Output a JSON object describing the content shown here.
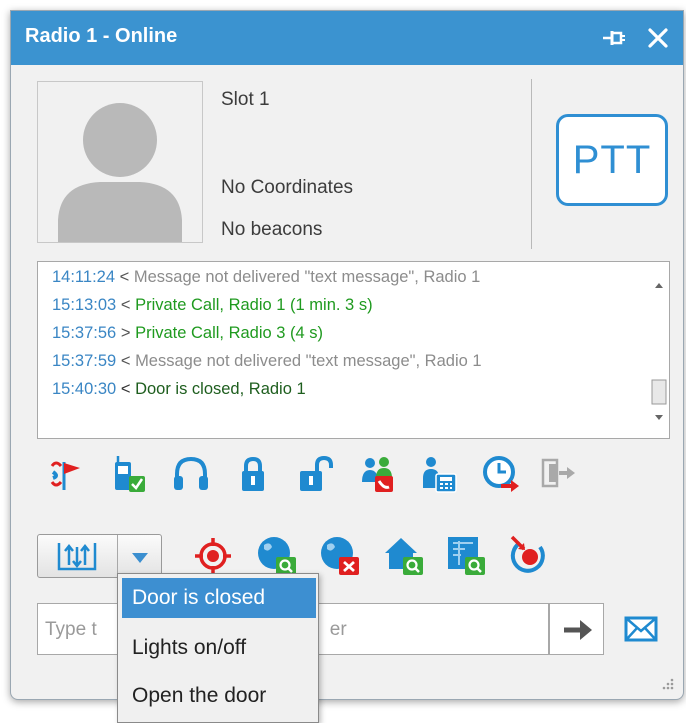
{
  "window": {
    "title": "Radio 1 - Online"
  },
  "titlebar": {
    "pin_icon": "pin-icon",
    "close_icon": "close-icon"
  },
  "info": {
    "slot": "Slot 1",
    "coordinates": "No Coordinates",
    "beacons": "No beacons",
    "avatar_icon": "user-avatar-placeholder"
  },
  "ptt_label": "PTT",
  "log": [
    {
      "time": "14:11:24",
      "dir": "<",
      "text": "Message not delivered \"text message\", Radio 1",
      "status": "gray"
    },
    {
      "time": "15:13:03",
      "dir": "<",
      "text": "Private Call, Radio 1 (1 min. 3 s)",
      "status": "green"
    },
    {
      "time": "15:37:56",
      "dir": ">",
      "text": "Private Call, Radio 3 (4 s)",
      "status": "green"
    },
    {
      "time": "15:37:59",
      "dir": "<",
      "text": "Message not delivered \"text message\", Radio 1",
      "status": "gray"
    },
    {
      "time": "15:40:30",
      "dir": "<",
      "text": "Door is closed, Radio 1",
      "status": "darkgreen"
    }
  ],
  "toolbar_row1": [
    "alarm-flag-icon",
    "radio-check-icon",
    "headset-icon",
    "lock-icon",
    "unlock-icon",
    "group-call-icon",
    "telephone-call-icon",
    "clock-arrow-icon",
    "exit-disabled-icon"
  ],
  "toolbar_row2": [
    "outputs-dropdown-icon",
    "target-locate-icon",
    "globe-search-icon",
    "globe-remove-icon",
    "home-search-icon",
    "map-search-icon",
    "remote-monitor-icon"
  ],
  "message": {
    "placeholder_prefix": "Type t",
    "placeholder_suffix": "er"
  },
  "menu": {
    "items": [
      "Door is closed",
      "Lights on/off",
      "Open the door"
    ],
    "selected": 0
  },
  "colors": {
    "accent": "#3b93d0",
    "ptt_border": "#2f8fd3",
    "log_time": "#3a86c4",
    "log_green": "#1f9a1f",
    "log_gray": "#8c8c8c",
    "menu_highlight": "#3d8fd1"
  }
}
